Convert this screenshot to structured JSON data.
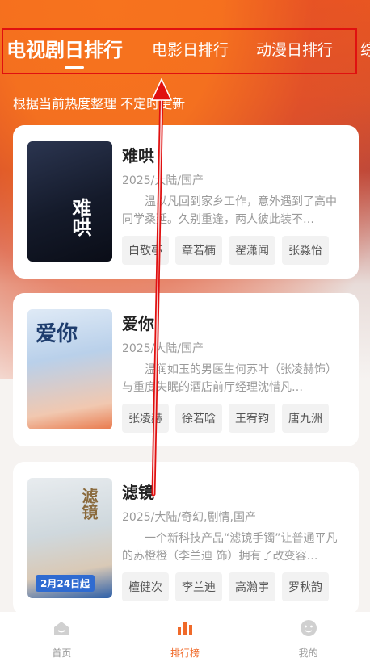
{
  "tabs": [
    {
      "label": "电视剧日排行",
      "active": true
    },
    {
      "label": "电影日排行",
      "active": false
    },
    {
      "label": "动漫日排行",
      "active": false
    },
    {
      "label": "综",
      "active": false
    }
  ],
  "subtitle": "根据当前热度整理 不定时更新",
  "cards": [
    {
      "title": "难哄",
      "meta": "2025/大陆/国产",
      "desc": "温以凡回到家乡工作，意外遇到了高中同学桑延。久别重逢，两人彼此装不…",
      "poster_text": "难哄",
      "tags": [
        "白敬亭",
        "章若楠",
        "翟潇闻",
        "张淼怡"
      ]
    },
    {
      "title": "爱你",
      "meta": "2025/大陆/国产",
      "desc": "温润如玉的男医生何苏叶（张凌赫饰）与重度失眠的酒店前厅经理沈惜凡…",
      "poster_text": "爱你",
      "tags": [
        "张凌赫",
        "徐若晗",
        "王宥钧",
        "唐九洲"
      ]
    },
    {
      "title": "滤镜",
      "meta": "2025/大陆/奇幻,剧情,国产",
      "desc": "一个新科技产品“滤镜手镯”让普通平凡的苏橙橙（李兰迪 饰）拥有了改变容…",
      "poster_text": "滤镜",
      "poster_date": "2月24日起",
      "tags": [
        "檀健次",
        "李兰迪",
        "高瀚宇",
        "罗秋韵"
      ]
    }
  ],
  "bottom_nav": [
    {
      "label": "首页",
      "icon": "home-icon",
      "active": false
    },
    {
      "label": "排行榜",
      "icon": "ranking-icon",
      "active": true
    },
    {
      "label": "我的",
      "icon": "profile-icon",
      "active": false
    }
  ],
  "colors": {
    "accent": "#f06a2a",
    "annotation": "#e01010"
  }
}
